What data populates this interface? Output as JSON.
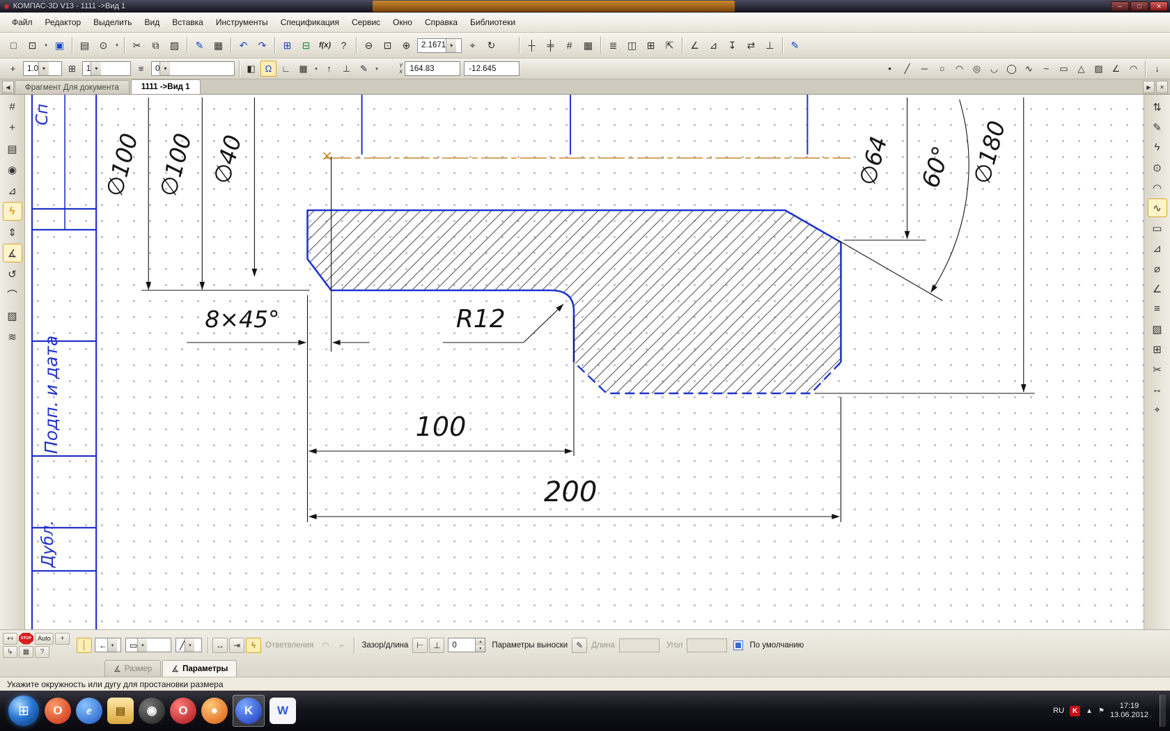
{
  "window": {
    "title": "КОМПАС-3D V13 - 1111 ->Вид 1",
    "logo": "◉",
    "min": "─",
    "max": "□",
    "close": "✕"
  },
  "menu": {
    "items": [
      "Файл",
      "Редактор",
      "Выделить",
      "Вид",
      "Вставка",
      "Инструменты",
      "Спецификация",
      "Сервис",
      "Окно",
      "Справка",
      "Библиотеки"
    ]
  },
  "toolbar": {
    "zoom_value": "2.1671",
    "fx": "f(x)",
    "line_width": "1.0",
    "layer_num": "1",
    "layer_sel": "0",
    "coord_y_label": "Y",
    "coord_x_label": "x",
    "coord_x": "164.83",
    "coord_y": "-12.645"
  },
  "tabs": {
    "prev": "◀",
    "next": "▶",
    "close": "✕",
    "t1": "Фрагмент Для документа",
    "t2": "1111 ->Вид 1"
  },
  "icons": {
    "caret": "▾",
    "new": "□",
    "open": "⊡",
    "save": "▣",
    "print": "▤",
    "preview": "⊙",
    "cut": "✂",
    "copy": "⧉",
    "paste": "▨",
    "brush": "✎",
    "table": "▦",
    "undo": "↶",
    "redo": "↷",
    "sheet": "⊞",
    "catalog": "⊟",
    "help_cursor": "?",
    "zoom_out": "⊖",
    "zoom_area": "⊡",
    "zoom_in": "⊕",
    "pan": "⌖",
    "rotate": "↻",
    "g1": "┼",
    "g2": "╪",
    "g3": "#",
    "g4": "▦",
    "g5": "≣",
    "g6": "◫",
    "g7": "⊞",
    "g8": "⇱",
    "g9": "∠",
    "g10": "⊿",
    "g11": "↧",
    "g12": "⇄",
    "g13": "⊥",
    "g14": "✎",
    "plus": "+",
    "layers": "≡",
    "paint": "◧",
    "magnet": "Ω",
    "angle": "∟",
    "gridb": "▦",
    "arrup": "↑",
    "perp": "⊥",
    "pencil": "✎",
    "pt": "•",
    "aux": "╱",
    "seg": "─",
    "circ": "○",
    "arc": "◠",
    "circ2": "◎",
    "arc2": "◡",
    "ell": "◯",
    "wave": "∿",
    "spl": "~",
    "rect": "▭",
    "poly": "△",
    "hatch": "▨",
    "cham": "∠",
    "fil": "◠",
    "panel_dn": "↓",
    "lt1": "#",
    "lt2": "+",
    "lt3": "▤",
    "lt4": "◉",
    "lt5": "⊿",
    "lt6": "ϟ",
    "lt7": "⇕",
    "lt8": "∡",
    "lt9": "↺",
    "lt10": "⌒",
    "lt11": "▨",
    "lt12": "≋",
    "rt1": "⇅",
    "rt2": "✎",
    "rt3": "ϟ",
    "rt4": "⊙",
    "rt5": "◠",
    "rt6": "∿",
    "rt7": "▭",
    "rt8": "⊿",
    "rt9": "⌀",
    "rt10": "∠",
    "rt11": "≡",
    "rt12": "▨",
    "rt13": "⊞",
    "rt14": "✂",
    "rt15": "↔",
    "rt16": "⌖",
    "back": "↤",
    "corner": "↳",
    "grid2": "▦",
    "qmark": "?",
    "move": "+",
    "vert": "│",
    "arrl": "←",
    "dimln": "▭",
    "slash": "╱",
    "wid": "↔",
    "snap": "⇥",
    "flash": "ϟ",
    "arc3": "◠",
    "corner2": "⌐",
    "tg1": "⊢",
    "tg2": "⊥",
    "note": "✎",
    "up": "▴",
    "dn": "▾",
    "dimtab": "∡"
  },
  "drawing": {
    "dims": {
      "d1": "∅100",
      "d2": "∅100",
      "d3": "∅40",
      "ch": "8×45°",
      "r": "R12",
      "l1": "100",
      "l2": "200",
      "d4": "∅64",
      "a": "60°",
      "d5": "∅180"
    },
    "frame": {
      "podp": "Подп. и дата",
      "dubl": "Дубл.",
      "sp": "Сп"
    },
    "marker": "x"
  },
  "prop": {
    "stop": "STOP",
    "auto": "Auto",
    "otv": "Ответвления",
    "zazor": "Зазор/длина",
    "zval": "0",
    "vyn": "Параметры выноски",
    "dlina": "Длина",
    "ugol": "Угол",
    "def": "По умолчанию",
    "tab1": "Размер",
    "tab2": "Параметры"
  },
  "status": {
    "msg": "Укажите окружность или дугу для простановки размера"
  },
  "taskbar": {
    "start": "⊞",
    "apps": [
      {
        "g": "O"
      },
      {
        "g": "e"
      },
      {
        "g": "▤"
      },
      {
        "g": "◉"
      },
      {
        "g": "O"
      },
      {
        "g": "●"
      },
      {
        "g": "K"
      },
      {
        "g": "W"
      }
    ],
    "ru": "RU",
    "badge": "K",
    "tray_up": "▲",
    "tray_flag": "⚑",
    "time": "17:19",
    "date": "13.06.2012"
  }
}
